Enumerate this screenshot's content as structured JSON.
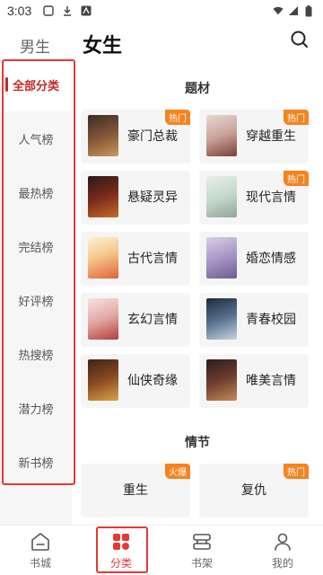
{
  "status_bar": {
    "time": "3:03"
  },
  "header": {
    "tab_male": "男生",
    "tab_female": "女生"
  },
  "sidebar": {
    "items": [
      {
        "label": "全部分类",
        "active": true
      },
      {
        "label": "人气榜"
      },
      {
        "label": "最热榜"
      },
      {
        "label": "完结榜"
      },
      {
        "label": "好评榜"
      },
      {
        "label": "热搜榜"
      },
      {
        "label": "潜力榜"
      },
      {
        "label": "新书榜"
      }
    ]
  },
  "sections": {
    "theme": {
      "title": "题材",
      "cards": [
        {
          "label": "豪门总裁",
          "badge": "热门"
        },
        {
          "label": "穿越重生",
          "badge": "热门"
        },
        {
          "label": "悬疑灵异",
          "badge": ""
        },
        {
          "label": "现代言情",
          "badge": "热门"
        },
        {
          "label": "古代言情",
          "badge": ""
        },
        {
          "label": "婚恋情感",
          "badge": ""
        },
        {
          "label": "玄幻言情",
          "badge": ""
        },
        {
          "label": "青春校园",
          "badge": ""
        },
        {
          "label": "仙侠奇缘",
          "badge": ""
        },
        {
          "label": "唯美言情",
          "badge": ""
        }
      ]
    },
    "plot": {
      "title": "情节",
      "cards": [
        {
          "label": "重生",
          "badge": "火爆"
        },
        {
          "label": "复仇",
          "badge": "热门"
        }
      ]
    }
  },
  "bottom_nav": {
    "items": [
      {
        "label": "书城",
        "icon": "bookstore-icon"
      },
      {
        "label": "分类",
        "icon": "category-icon",
        "active": true
      },
      {
        "label": "书架",
        "icon": "bookshelf-icon"
      },
      {
        "label": "我的",
        "icon": "profile-icon"
      }
    ]
  },
  "colors": {
    "accent": "#e53935",
    "badge": "#f5831f",
    "active_text": "#c62828"
  }
}
